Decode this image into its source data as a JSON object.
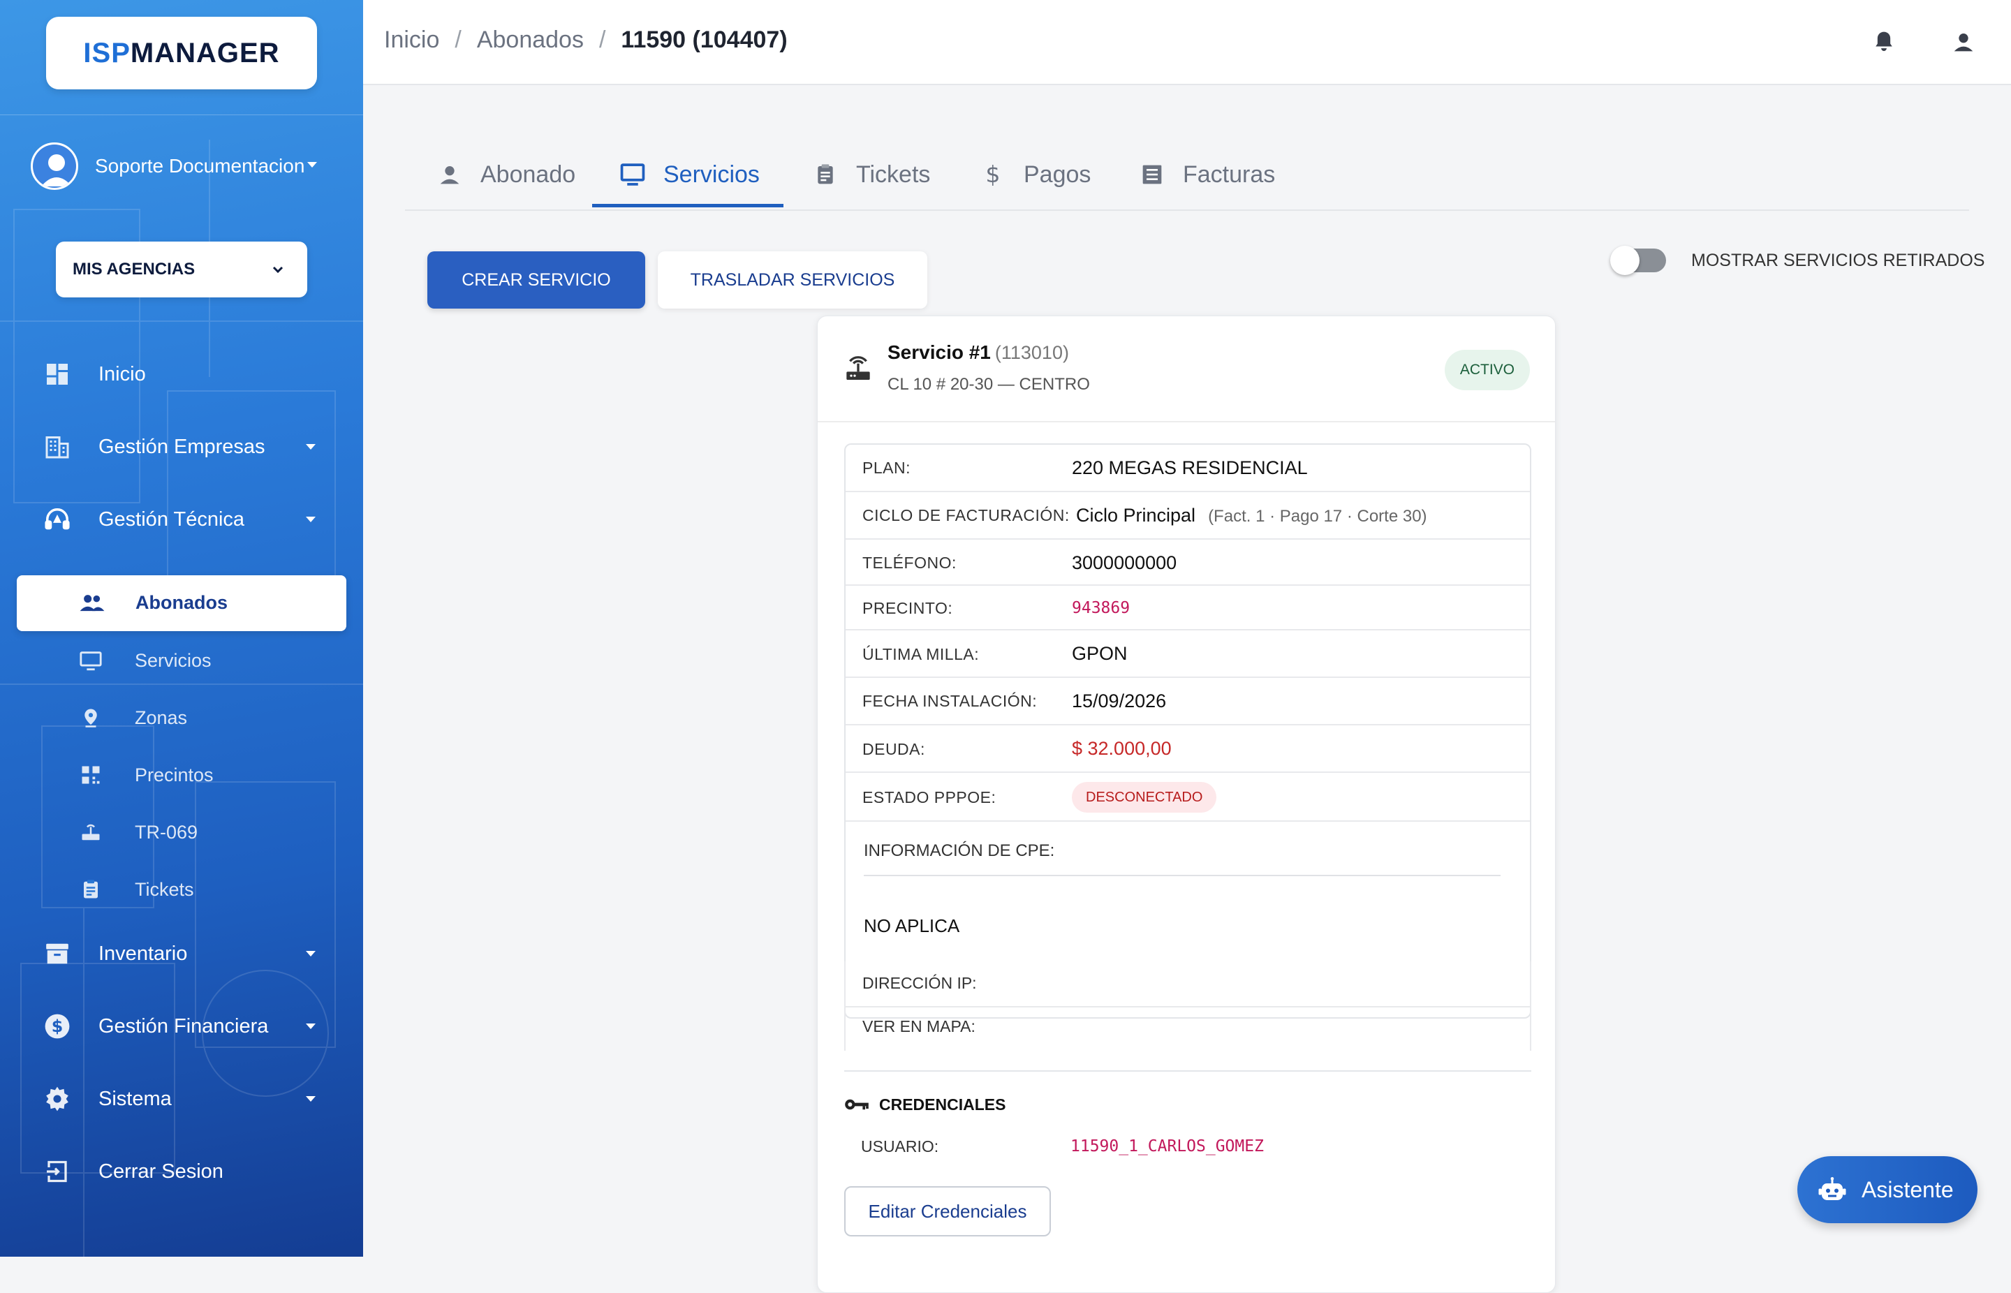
{
  "brand": {
    "logo_isp": "ISP",
    "logo_manager": "MANAGER"
  },
  "user": {
    "name": "Soporte Documentacion"
  },
  "agency_selector": {
    "label": "MIS AGENCIAS"
  },
  "sidebar": {
    "items": [
      {
        "label": "Inicio",
        "icon": "dashboard-icon"
      },
      {
        "label": "Gestión Empresas",
        "icon": "building-icon"
      },
      {
        "label": "Gestión Técnica",
        "icon": "headset-icon"
      },
      {
        "label": "Inventario",
        "icon": "archive-icon"
      },
      {
        "label": "Gestión Financiera",
        "icon": "dollar-icon"
      },
      {
        "label": "Sistema",
        "icon": "gear-icon"
      },
      {
        "label": "Cerrar Sesion",
        "icon": "logout-icon"
      }
    ],
    "sub_items": [
      {
        "label": "Abonados",
        "icon": "users-icon"
      },
      {
        "label": "Servicios",
        "icon": "monitor-icon"
      },
      {
        "label": "Zonas",
        "icon": "pin-icon"
      },
      {
        "label": "Precintos",
        "icon": "qr-icon"
      },
      {
        "label": "TR-069",
        "icon": "router-icon"
      },
      {
        "label": "Tickets",
        "icon": "clipboard-icon"
      }
    ]
  },
  "breadcrumb": {
    "home": "Inicio",
    "section": "Abonados",
    "current": "11590 (104407)"
  },
  "tabs": [
    {
      "label": "Abonado"
    },
    {
      "label": "Servicios"
    },
    {
      "label": "Tickets"
    },
    {
      "label": "Pagos"
    },
    {
      "label": "Facturas"
    }
  ],
  "actions": {
    "create": "CREAR SERVICIO",
    "move": "TRASLADAR SERVICIOS",
    "toggle_label": "MOSTRAR SERVICIOS RETIRADOS"
  },
  "service": {
    "title": "Servicio #1",
    "code": "(113010)",
    "address": "CL 10 # 20-30 — CENTRO",
    "status": "ACTIVO",
    "fields": {
      "plan_k": "PLAN:",
      "plan_v": "220 MEGAS RESIDENCIAL",
      "cycle_k": "CICLO DE FACTURACIÓN:",
      "cycle_v": "Ciclo Principal",
      "cycle_sub": "(Fact. 1 · Pago 17 · Corte 30)",
      "phone_k": "TELÉFONO:",
      "phone_v": "3000000000",
      "seal_k": "PRECINTO:",
      "seal_v": "943869",
      "lastmile_k": "ÚLTIMA MILLA:",
      "lastmile_v": "GPON",
      "install_k": "FECHA INSTALACIÓN:",
      "install_v": "15/09/2026",
      "debt_k": "DEUDA:",
      "debt_v": "$ 32.000,00",
      "pppoe_k": "ESTADO PPPOE:",
      "pppoe_v": "DESCONECTADO",
      "cpe_k": "INFORMACIÓN DE CPE:",
      "cpe_v": "NO APLICA",
      "ip_k": "DIRECCIÓN IP:",
      "map_k": "VER EN MAPA:"
    },
    "credentials": {
      "title": "CREDENCIALES",
      "user_k": "USUARIO:",
      "user_v": "11590_1_CARLOS_GOMEZ",
      "edit": "Editar Credenciales"
    }
  },
  "assistant": {
    "label": "Asistente"
  },
  "colors": {
    "primary": "#2a5fc1",
    "accent_tab": "#1f5fbf",
    "debt": "#c62828",
    "mono": "#c2185b"
  }
}
